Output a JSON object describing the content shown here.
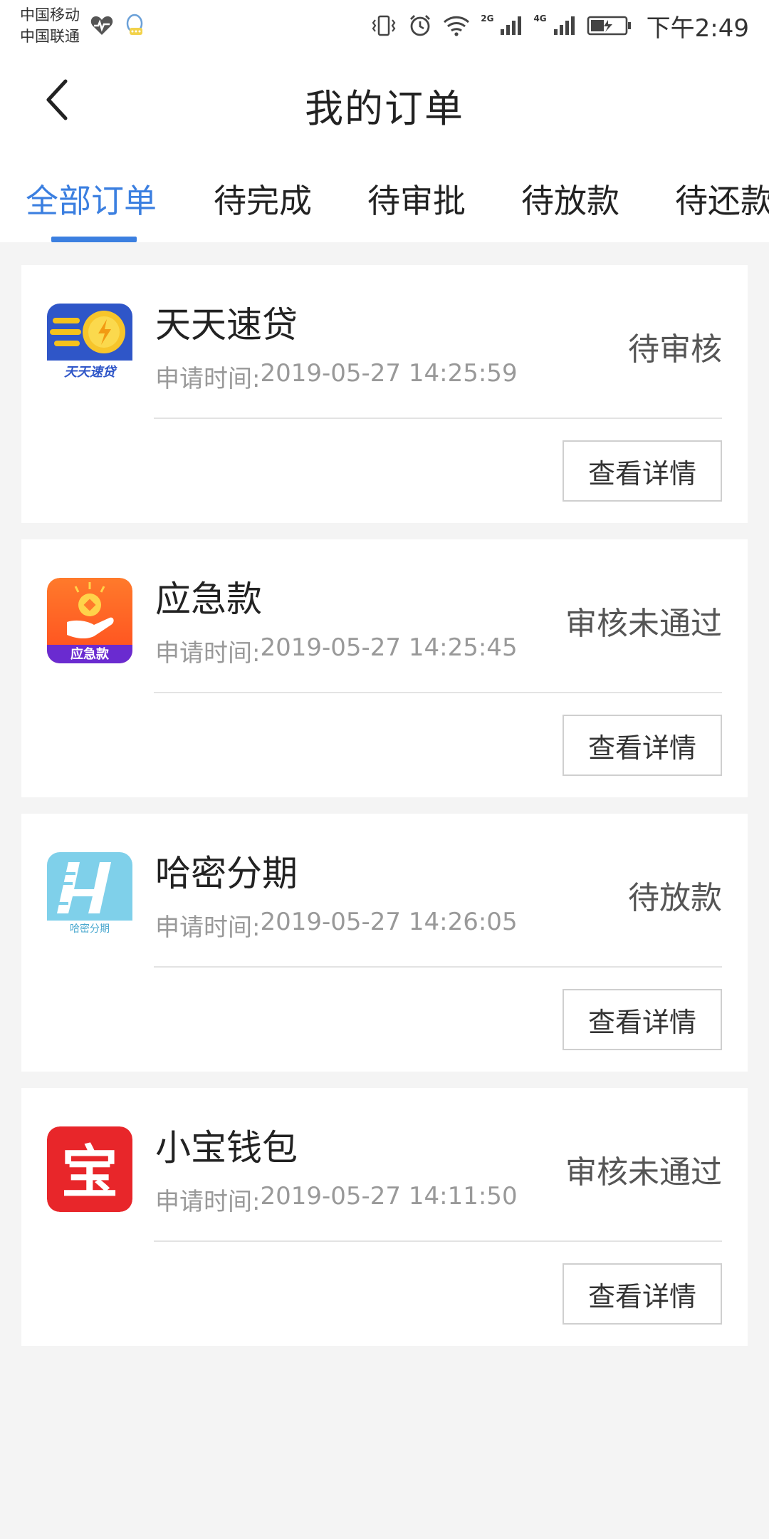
{
  "status_bar": {
    "carrier_1": "中国移动",
    "carrier_2": "中国联通",
    "net_2g": "2G",
    "net_4g": "4G",
    "time": "下午2:49"
  },
  "header": {
    "title": "我的订单"
  },
  "tabs": [
    {
      "label": "全部订单",
      "active": true
    },
    {
      "label": "待完成"
    },
    {
      "label": "待审批"
    },
    {
      "label": "待放款"
    },
    {
      "label": "待还款"
    }
  ],
  "orders": [
    {
      "name": "天天速贷",
      "time_label": "申请时间:",
      "time": "2019-05-27 14:25:59",
      "status": "待审核",
      "button": "查看详情",
      "logo_text": "天天速贷"
    },
    {
      "name": "应急款",
      "time_label": "申请时间:",
      "time": "2019-05-27 14:25:45",
      "status": "审核未通过",
      "button": "查看详情",
      "logo_text": "应急款"
    },
    {
      "name": "哈密分期",
      "time_label": "申请时间:",
      "time": "2019-05-27 14:26:05",
      "status": "待放款",
      "button": "查看详情",
      "logo_text": "哈密分期"
    },
    {
      "name": "小宝钱包",
      "time_label": "申请时间:",
      "time": "2019-05-27 14:11:50",
      "status": "审核未通过",
      "button": "查看详情",
      "logo_text": "宝"
    }
  ],
  "colors": {
    "accent": "#3b7fe0",
    "background": "#f4f4f4"
  }
}
